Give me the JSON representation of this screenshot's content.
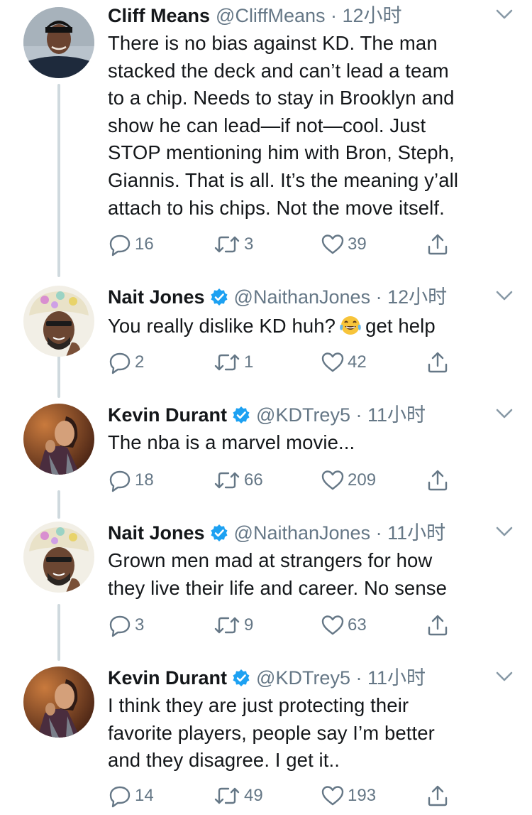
{
  "tweets": [
    {
      "name": "Cliff Means",
      "verified": false,
      "handle": "@CliffMeans",
      "time": "12小时",
      "lines": [
        "There is no bias against KD. The man",
        "stacked the deck and can’t lead a team",
        "to a chip. Needs to stay in Brooklyn and",
        "show he can lead—if not—cool. Just",
        "STOP mentioning him with Bron, Steph,",
        "Giannis. That is all. It’s the meaning y’all",
        "attach to his chips. Not the move itself."
      ],
      "replies": "16",
      "retweets": "3",
      "likes": "39"
    },
    {
      "name": "Nait Jones",
      "verified": true,
      "handle": "@NaithanJones",
      "time": "12小时",
      "text_before_emoji": "You really dislike KD huh?",
      "emoji": "face-with-tears-of-joy",
      "text_after_emoji": "get help",
      "replies": "2",
      "retweets": "1",
      "likes": "42"
    },
    {
      "name": "Kevin Durant",
      "verified": true,
      "handle": "@KDTrey5",
      "time": "11小时",
      "lines": [
        "The nba is a marvel movie..."
      ],
      "replies": "18",
      "retweets": "66",
      "likes": "209"
    },
    {
      "name": "Nait Jones",
      "verified": true,
      "handle": "@NaithanJones",
      "time": "11小时",
      "lines": [
        "Grown men mad at strangers for how",
        "they live their life and career. No sense"
      ],
      "replies": "3",
      "retweets": "9",
      "likes": "63"
    },
    {
      "name": "Kevin Durant",
      "verified": true,
      "handle": "@KDTrey5",
      "time": "11小时",
      "lines": [
        "I think they are just protecting their",
        "favorite players, people say I’m better",
        "and they disagree. I get it.."
      ],
      "replies": "14",
      "retweets": "49",
      "likes": "193"
    }
  ],
  "separator": "·",
  "colors": {
    "text": "#14171a",
    "secondary": "#657786",
    "verified": "#1da1f2",
    "thread_line": "#cfd9de"
  },
  "icons": [
    "reply-icon",
    "retweet-icon",
    "like-icon",
    "share-icon",
    "chevron-down-icon",
    "verified-badge-icon"
  ]
}
